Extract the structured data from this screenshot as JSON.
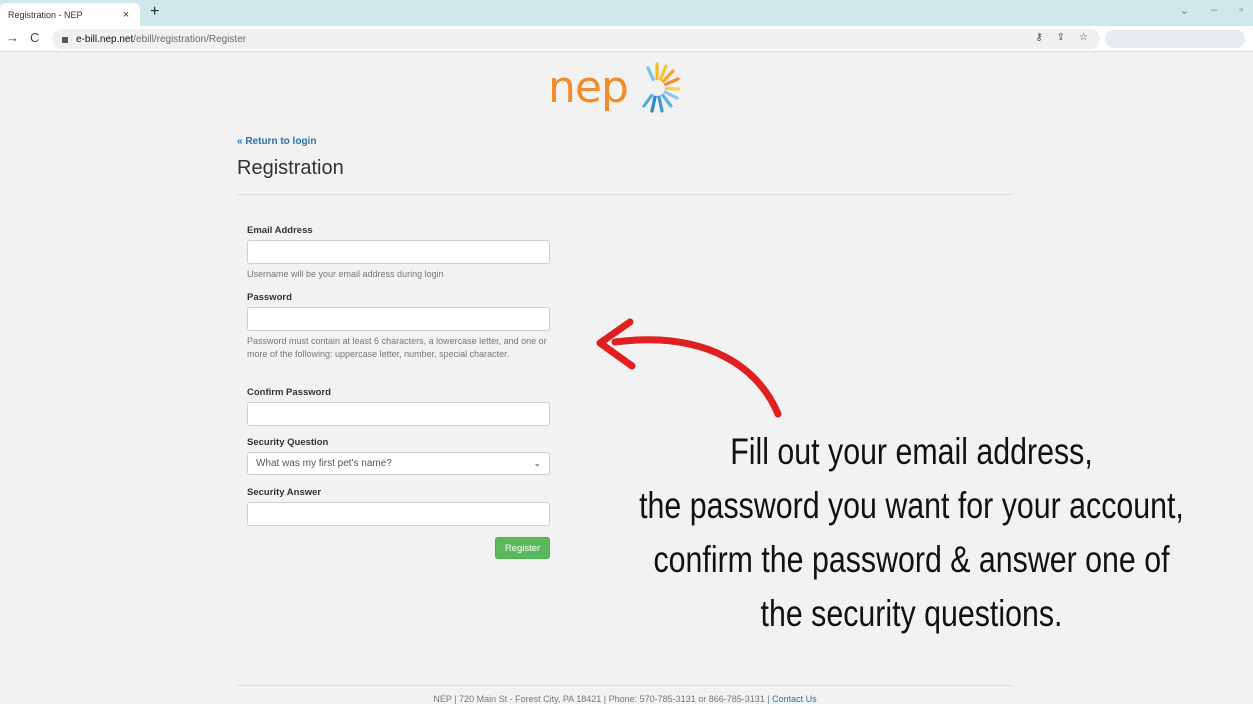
{
  "browser": {
    "tab_title": "Registration - NEP",
    "tab_close": "×",
    "new_tab": "+",
    "url_host": "e-bill.nep.net",
    "url_path": "/ebill/registration/Register"
  },
  "logo": {
    "text": "nep"
  },
  "page": {
    "return_link": "« Return to login",
    "title": "Registration"
  },
  "form": {
    "email_label": "Email Address",
    "email_value": "",
    "email_help": "Username will be your email address during login",
    "password_label": "Password",
    "password_value": "",
    "password_help": "Password must contain at least 6 characters, a lowercase letter, and one or more of the following: uppercase letter, number, special character.",
    "confirm_label": "Confirm Password",
    "confirm_value": "",
    "question_label": "Security Question",
    "question_selected": "What was my first pet's name?",
    "answer_label": "Security Answer",
    "answer_value": "",
    "register_button": "Register"
  },
  "annotation": {
    "lines": [
      "Fill out your email address,",
      "the password you want for your account,",
      "confirm the password & answer one of",
      "the security questions."
    ]
  },
  "footer": {
    "text": "NEP | 720 Main St - Forest City, PA 18421 | Phone: 570-785-3131 or 866-785-3131 | ",
    "contact_link": "Contact Us"
  },
  "colors": {
    "brand_orange": "#f28c28",
    "register_green": "#5cb85c",
    "link_blue": "#2a6fb0",
    "arrow_red": "#e02020"
  }
}
